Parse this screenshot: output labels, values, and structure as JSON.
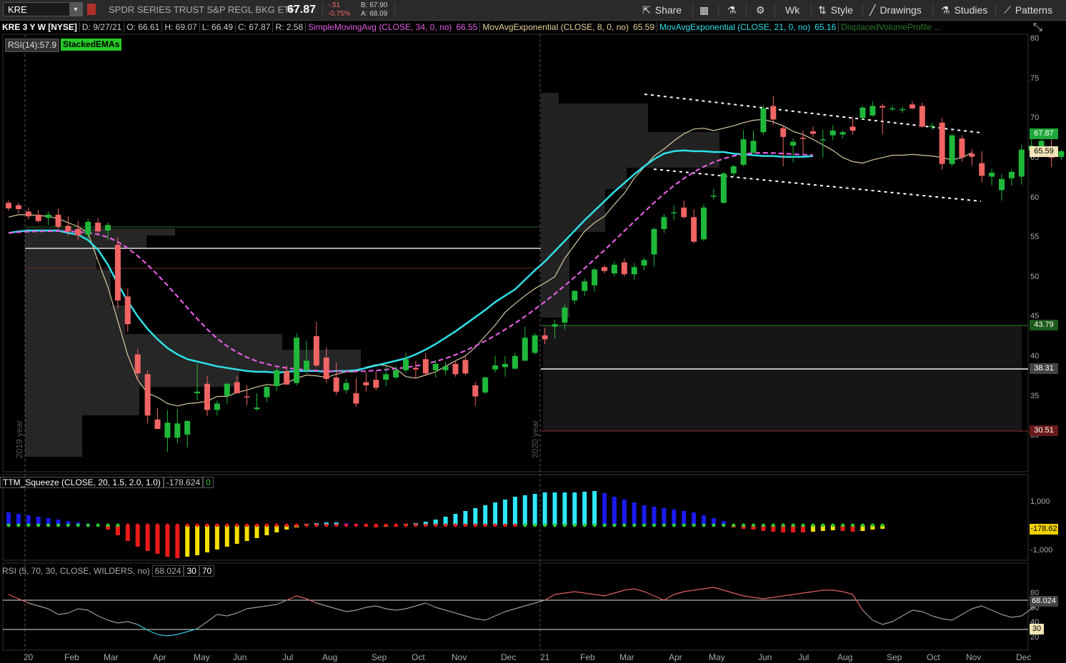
{
  "toolbar": {
    "symbol": "KRE",
    "description": "SPDR SERIES TRUST S&P REGL BKG ETF",
    "last": "67.87",
    "change": "-.51",
    "change_pct": "-0.75%",
    "bid": "B: 67.90",
    "ask": "A: 68.09",
    "share_label": "Share",
    "timeframe": "Wk",
    "style_label": "Style",
    "drawings_label": "Drawings",
    "studies_label": "Studies",
    "patterns_label": "Patterns"
  },
  "header": {
    "title": "KRE 3 Y W [NYSE]",
    "date": "D: 9/27/21",
    "open": "O: 66.61",
    "high": "H: 69.07",
    "low": "L: 66.49",
    "close": "C: 67.87",
    "range": "R: 2.58",
    "sma_label": "SimpleMovingAvg (CLOSE, 34, 0, no)",
    "sma_value": "66.55",
    "ema8_label": "MovAvgExponential (CLOSE, 8, 0, no)",
    "ema8_value": "65.59",
    "ema21_label": "MovAvgExponential (CLOSE, 21, 0, no)",
    "ema21_value": "65.16",
    "dvp_label": "DisplacedVolumeProfile ..."
  },
  "labels": {
    "rsi_chip": "RSI(14):57.9",
    "stacked_chip": "StackedEMAs",
    "year2019": "2019 year",
    "year2020": "2020 year"
  },
  "price_axis": {
    "ticks": [
      "80",
      "75",
      "70",
      "65",
      "60",
      "55",
      "50",
      "45",
      "40",
      "35",
      "30"
    ],
    "last_box": "67.87",
    "ema8_box": "65.59",
    "hi_box": "43.79",
    "poc_box": "38.31",
    "lo_box": "30.51"
  },
  "squeeze": {
    "label": "TTM_Squeeze (CLOSE, 20, 1.5, 2.0, 1.0)",
    "value": "-178.624",
    "flag": "0",
    "tick_top": "1,000",
    "tick_bottom": "-1,000",
    "box": "-178.62"
  },
  "rsi": {
    "label": "RSI (5, 70, 30, CLOSE, WILDERS, no)",
    "value": "68.024",
    "lower": "30",
    "upper": "70",
    "tick80": "80",
    "tick60": "60",
    "tick40": "40",
    "tick20": "20",
    "box": "68.024",
    "box30": "30"
  },
  "x_axis": [
    "20",
    "Feb",
    "Mar",
    "Apr",
    "May",
    "Jun",
    "Jul",
    "Aug",
    "Sep",
    "Oct",
    "Nov",
    "Dec",
    "21",
    "Feb",
    "Mar",
    "Apr",
    "May",
    "Jun",
    "Jul",
    "Aug",
    "Sep",
    "Oct",
    "Nov",
    "Dec"
  ],
  "colors": {
    "up": "#1fb83a",
    "down": "#f06464",
    "ema8": "#d9c7a0",
    "ema21": "#2ee0e8",
    "sma": "#e05ee0"
  },
  "chart_data": {
    "type": "candlestick",
    "ylim": [
      28,
      82
    ],
    "candles": [
      {
        "o": 59.3,
        "h": 59.6,
        "l": 58.3,
        "c": 58.6
      },
      {
        "o": 59.0,
        "h": 59.3,
        "l": 58.0,
        "c": 58.5
      },
      {
        "o": 58.2,
        "h": 58.7,
        "l": 57.2,
        "c": 57.6
      },
      {
        "o": 57.8,
        "h": 58.4,
        "l": 56.8,
        "c": 57.0
      },
      {
        "o": 57.4,
        "h": 58.2,
        "l": 56.5,
        "c": 57.8
      },
      {
        "o": 57.8,
        "h": 58.6,
        "l": 56.0,
        "c": 56.3
      },
      {
        "o": 56.4,
        "h": 57.6,
        "l": 55.1,
        "c": 55.7
      },
      {
        "o": 56.0,
        "h": 57.0,
        "l": 54.6,
        "c": 55.2
      },
      {
        "o": 55.3,
        "h": 57.3,
        "l": 54.4,
        "c": 56.9
      },
      {
        "o": 56.8,
        "h": 57.4,
        "l": 55.3,
        "c": 55.7
      },
      {
        "o": 55.8,
        "h": 56.8,
        "l": 54.6,
        "c": 56.5
      },
      {
        "o": 54.0,
        "h": 55.0,
        "l": 46.0,
        "c": 47.0
      },
      {
        "o": 47.5,
        "h": 48.5,
        "l": 43.0,
        "c": 44.0
      },
      {
        "o": 40.2,
        "h": 40.9,
        "l": 36.9,
        "c": 37.8
      },
      {
        "o": 37.7,
        "h": 38.2,
        "l": 31.5,
        "c": 32.5
      },
      {
        "o": 32.0,
        "h": 33.4,
        "l": 30.8,
        "c": 30.8
      },
      {
        "o": 29.7,
        "h": 33.2,
        "l": 27.9,
        "c": 31.6
      },
      {
        "o": 29.7,
        "h": 33.3,
        "l": 29.0,
        "c": 31.5
      },
      {
        "o": 30.1,
        "h": 31.9,
        "l": 28.5,
        "c": 31.8
      },
      {
        "o": 35.3,
        "h": 39.0,
        "l": 34.4,
        "c": 35.5
      },
      {
        "o": 36.5,
        "h": 37.5,
        "l": 32.4,
        "c": 33.2
      },
      {
        "o": 33.2,
        "h": 34.4,
        "l": 32.5,
        "c": 34.0
      },
      {
        "o": 35.0,
        "h": 36.6,
        "l": 34.0,
        "c": 36.5
      },
      {
        "o": 36.7,
        "h": 37.5,
        "l": 35.3,
        "c": 35.3
      },
      {
        "o": 34.9,
        "h": 36.3,
        "l": 33.8,
        "c": 34.8
      },
      {
        "o": 33.3,
        "h": 35.3,
        "l": 33.1,
        "c": 33.5
      },
      {
        "o": 34.8,
        "h": 36.5,
        "l": 34.2,
        "c": 36.1
      },
      {
        "o": 36.2,
        "h": 38.5,
        "l": 35.6,
        "c": 38.2
      },
      {
        "o": 38.1,
        "h": 38.8,
        "l": 36.4,
        "c": 36.4
      },
      {
        "o": 36.6,
        "h": 42.8,
        "l": 36.3,
        "c": 42.3
      },
      {
        "o": 38.2,
        "h": 41.9,
        "l": 37.8,
        "c": 39.4
      },
      {
        "o": 42.5,
        "h": 44.3,
        "l": 38.6,
        "c": 38.8
      },
      {
        "o": 39.8,
        "h": 41.1,
        "l": 36.6,
        "c": 37.1
      },
      {
        "o": 37.3,
        "h": 39.2,
        "l": 35.1,
        "c": 35.5
      },
      {
        "o": 35.7,
        "h": 37.1,
        "l": 35.3,
        "c": 36.6
      },
      {
        "o": 35.3,
        "h": 37.2,
        "l": 33.6,
        "c": 34.0
      },
      {
        "o": 36.7,
        "h": 38.0,
        "l": 35.5,
        "c": 36.3
      },
      {
        "o": 37.0,
        "h": 38.1,
        "l": 35.7,
        "c": 36.0
      },
      {
        "o": 37.0,
        "h": 38.8,
        "l": 36.2,
        "c": 37.7
      },
      {
        "o": 37.3,
        "h": 38.7,
        "l": 37.1,
        "c": 38.2
      },
      {
        "o": 38.2,
        "h": 40.4,
        "l": 37.8,
        "c": 39.6
      },
      {
        "o": 38.5,
        "h": 39.4,
        "l": 37.2,
        "c": 38.3
      },
      {
        "o": 39.6,
        "h": 40.4,
        "l": 37.5,
        "c": 37.8
      },
      {
        "o": 38.2,
        "h": 39.5,
        "l": 37.3,
        "c": 39.0
      },
      {
        "o": 38.2,
        "h": 39.3,
        "l": 37.6,
        "c": 38.7
      },
      {
        "o": 39.0,
        "h": 39.3,
        "l": 37.4,
        "c": 37.7
      },
      {
        "o": 39.5,
        "h": 39.9,
        "l": 37.6,
        "c": 37.8
      },
      {
        "o": 36.3,
        "h": 36.7,
        "l": 33.7,
        "c": 34.9
      },
      {
        "o": 35.4,
        "h": 37.4,
        "l": 35.2,
        "c": 37.3
      },
      {
        "o": 38.3,
        "h": 40.0,
        "l": 37.9,
        "c": 38.8
      },
      {
        "o": 38.6,
        "h": 40.0,
        "l": 37.4,
        "c": 39.0
      },
      {
        "o": 38.4,
        "h": 40.4,
        "l": 38.3,
        "c": 40.0
      },
      {
        "o": 39.4,
        "h": 43.7,
        "l": 39.4,
        "c": 42.3
      },
      {
        "o": 40.4,
        "h": 42.9,
        "l": 40.2,
        "c": 42.6
      },
      {
        "o": 42.6,
        "h": 43.5,
        "l": 41.5,
        "c": 42.1
      },
      {
        "o": 43.7,
        "h": 44.6,
        "l": 42.2,
        "c": 44.0
      },
      {
        "o": 44.2,
        "h": 46.5,
        "l": 43.3,
        "c": 46.1
      },
      {
        "o": 47.0,
        "h": 48.3,
        "l": 46.5,
        "c": 48.2
      },
      {
        "o": 48.2,
        "h": 49.8,
        "l": 47.6,
        "c": 49.4
      },
      {
        "o": 48.9,
        "h": 51.1,
        "l": 48.1,
        "c": 50.9
      },
      {
        "o": 51.2,
        "h": 51.5,
        "l": 50.4,
        "c": 50.7
      },
      {
        "o": 50.4,
        "h": 51.9,
        "l": 50.0,
        "c": 51.5
      },
      {
        "o": 51.8,
        "h": 52.3,
        "l": 50.0,
        "c": 50.3
      },
      {
        "o": 50.3,
        "h": 51.7,
        "l": 49.6,
        "c": 51.2
      },
      {
        "o": 51.4,
        "h": 52.4,
        "l": 50.8,
        "c": 52.1
      },
      {
        "o": 52.8,
        "h": 56.2,
        "l": 51.3,
        "c": 56.0
      },
      {
        "o": 56.0,
        "h": 57.9,
        "l": 55.5,
        "c": 57.5
      },
      {
        "o": 58.0,
        "h": 59.0,
        "l": 57.1,
        "c": 58.1
      },
      {
        "o": 58.7,
        "h": 59.6,
        "l": 57.3,
        "c": 57.5
      },
      {
        "o": 57.5,
        "h": 58.5,
        "l": 54.2,
        "c": 54.4
      },
      {
        "o": 54.7,
        "h": 59.1,
        "l": 54.5,
        "c": 58.7
      },
      {
        "o": 60.1,
        "h": 61.0,
        "l": 59.7,
        "c": 60.2
      },
      {
        "o": 59.3,
        "h": 63.2,
        "l": 59.2,
        "c": 63.0
      },
      {
        "o": 63.0,
        "h": 64.1,
        "l": 62.6,
        "c": 63.9
      },
      {
        "o": 64.1,
        "h": 68.5,
        "l": 63.9,
        "c": 67.3
      },
      {
        "o": 65.6,
        "h": 68.4,
        "l": 65.5,
        "c": 67.1
      },
      {
        "o": 68.2,
        "h": 71.6,
        "l": 67.9,
        "c": 71.2
      },
      {
        "o": 71.5,
        "h": 72.7,
        "l": 69.1,
        "c": 69.8
      },
      {
        "o": 68.7,
        "h": 69.0,
        "l": 63.9,
        "c": 67.6
      },
      {
        "o": 66.5,
        "h": 67.4,
        "l": 64.4,
        "c": 67.0
      },
      {
        "o": 67.5,
        "h": 68.4,
        "l": 65.5,
        "c": 67.4
      },
      {
        "o": 68.3,
        "h": 68.9,
        "l": 67.6,
        "c": 68.0
      },
      {
        "o": 67.2,
        "h": 68.5,
        "l": 65.0,
        "c": 67.3
      },
      {
        "o": 67.8,
        "h": 69.1,
        "l": 67.2,
        "c": 68.4
      },
      {
        "o": 67.9,
        "h": 68.4,
        "l": 67.4,
        "c": 68.2
      },
      {
        "o": 68.9,
        "h": 70.1,
        "l": 67.9,
        "c": 68.4
      },
      {
        "o": 70.0,
        "h": 71.5,
        "l": 69.8,
        "c": 71.3
      },
      {
        "o": 70.3,
        "h": 72.1,
        "l": 70.2,
        "c": 71.5
      },
      {
        "o": 71.5,
        "h": 71.8,
        "l": 67.9,
        "c": 71.3
      },
      {
        "o": 71.2,
        "h": 71.6,
        "l": 70.9,
        "c": 71.2
      },
      {
        "o": 71.0,
        "h": 71.4,
        "l": 70.6,
        "c": 71.1
      },
      {
        "o": 71.7,
        "h": 72.1,
        "l": 71.1,
        "c": 71.2
      },
      {
        "o": 71.5,
        "h": 71.9,
        "l": 68.8,
        "c": 68.9
      },
      {
        "o": 69.0,
        "h": 69.4,
        "l": 68.5,
        "c": 69.0
      },
      {
        "o": 69.4,
        "h": 70.0,
        "l": 63.5,
        "c": 64.2
      },
      {
        "o": 64.2,
        "h": 68.0,
        "l": 63.9,
        "c": 67.8
      },
      {
        "o": 67.4,
        "h": 67.8,
        "l": 64.5,
        "c": 65.0
      },
      {
        "o": 65.5,
        "h": 66.1,
        "l": 64.0,
        "c": 65.1
      },
      {
        "o": 64.3,
        "h": 65.8,
        "l": 61.9,
        "c": 62.7
      },
      {
        "o": 62.6,
        "h": 63.6,
        "l": 61.5,
        "c": 63.1
      },
      {
        "o": 60.9,
        "h": 62.9,
        "l": 59.6,
        "c": 62.3
      },
      {
        "o": 62.4,
        "h": 63.5,
        "l": 61.5,
        "c": 63.2
      },
      {
        "o": 62.6,
        "h": 66.6,
        "l": 61.6,
        "c": 66.0
      },
      {
        "o": 65.9,
        "h": 67.3,
        "l": 64.9,
        "c": 66.5
      },
      {
        "o": 66.2,
        "h": 67.9,
        "l": 66.1,
        "c": 67.1
      },
      {
        "o": 66.1,
        "h": 67.3,
        "l": 63.8,
        "c": 65.0
      },
      {
        "o": 65.1,
        "h": 66.0,
        "l": 64.7,
        "c": 65.8
      },
      {
        "o": 66.3,
        "h": 67.8,
        "l": 65.8,
        "c": 67.5
      },
      {
        "o": 67.6,
        "h": 67.7,
        "l": 65.8,
        "c": 66.1
      },
      {
        "o": 66.4,
        "h": 66.9,
        "l": 65.6,
        "c": 65.7
      },
      {
        "o": 65.9,
        "h": 66.5,
        "l": 64.0,
        "c": 64.3
      },
      {
        "o": 64.2,
        "h": 64.8,
        "l": 63.1,
        "c": 64.6
      },
      {
        "o": 64.5,
        "h": 64.9,
        "l": 62.8,
        "c": 64.2
      },
      {
        "o": 61.7,
        "h": 66.1,
        "l": 60.8,
        "c": 66.1
      },
      {
        "o": 66.6,
        "h": 69.1,
        "l": 66.5,
        "c": 67.9
      }
    ],
    "ema8": [
      57.5,
      57.8,
      57.8,
      57.7,
      57.6,
      57.3,
      56.8,
      56.3,
      55.5,
      52.0,
      48.7,
      44.4,
      40.1,
      37.0,
      35.3,
      34.8,
      34.0,
      33.7,
      34.0,
      34.1,
      34.3,
      34.9,
      34.9,
      35.4,
      35.7,
      36.1,
      36.4,
      36.3,
      36.6,
      37.2,
      37.6,
      37.5,
      37.3,
      37.7,
      38.0,
      38.0,
      38.6,
      38.9,
      38.8,
      38.4,
      37.4,
      37.2,
      37.6,
      38.0,
      38.7,
      39.4,
      40.0,
      41.1,
      42.5,
      43.9,
      45.5,
      46.6,
      47.6,
      48.5,
      49.2,
      50.0,
      52.3,
      54.0,
      55.7,
      56.8,
      57.6,
      59.1,
      60.5,
      62.4,
      63.8,
      65.2,
      66.1,
      67.1,
      68.0,
      68.6,
      68.7,
      68.4,
      68.7,
      69.0,
      69.4,
      69.7,
      69.8,
      69.5,
      69.0,
      68.3,
      67.9,
      67.3,
      66.6,
      65.9,
      65.0,
      64.5,
      64.3,
      64.7,
      65.0,
      65.3,
      65.3,
      65.4,
      65.3,
      65.2,
      65.0,
      64.7,
      65.0,
      65.6
    ],
    "ema21": [
      55.5,
      55.7,
      55.8,
      55.8,
      55.8,
      55.8,
      55.5,
      55.3,
      54.6,
      53.4,
      51.5,
      49.1,
      46.9,
      45.0,
      43.4,
      42.1,
      41.0,
      40.2,
      39.6,
      39.3,
      39.0,
      38.7,
      38.5,
      38.3,
      38.1,
      38.0,
      38.0,
      37.9,
      38.0,
      38.1,
      38.1,
      38.1,
      38.0,
      38.1,
      38.1,
      38.2,
      38.5,
      38.8,
      39.1,
      39.4,
      39.7,
      40.2,
      40.8,
      41.5,
      42.3,
      43.1,
      44.0,
      44.9,
      45.8,
      46.8,
      47.6,
      48.4,
      49.6,
      50.8,
      51.9,
      53.2,
      54.5,
      55.8,
      57.1,
      58.3,
      59.5,
      60.7,
      61.8,
      62.9,
      63.9,
      64.8,
      65.5,
      65.8,
      65.9,
      65.8,
      65.8,
      65.7,
      65.7,
      65.5,
      65.4,
      65.3,
      65.2,
      65.2,
      65.1,
      65.1,
      65.1,
      65.2
    ]
  }
}
